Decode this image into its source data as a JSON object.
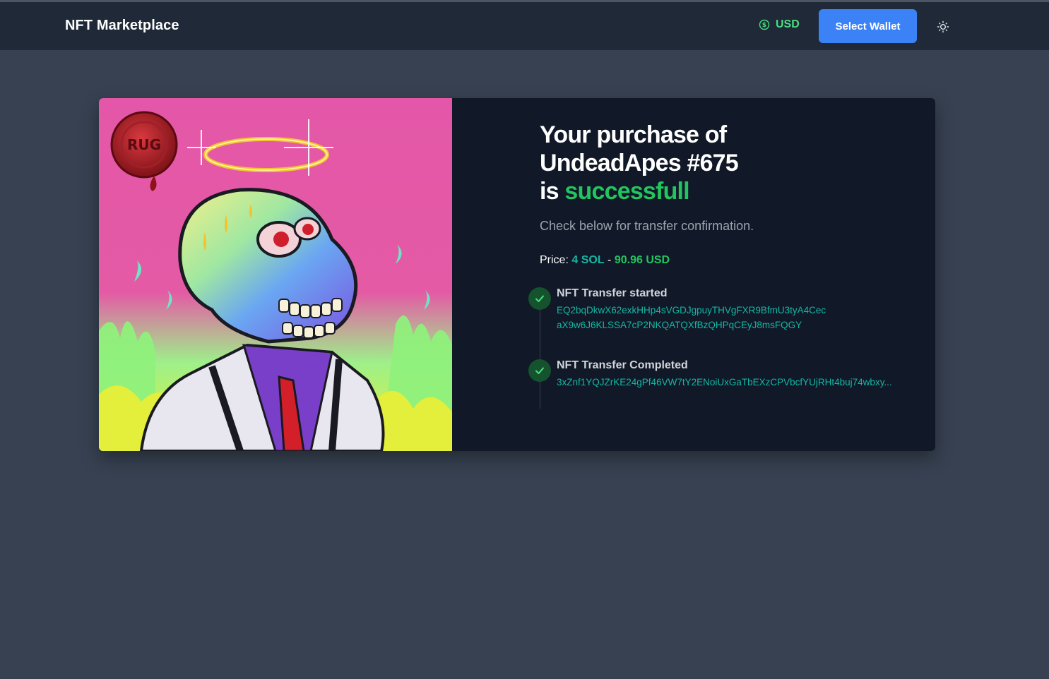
{
  "header": {
    "brand": "NFT Marketplace",
    "currency_label": "USD",
    "currency_icon": "dollar-circle-icon",
    "wallet_button": "Select Wallet",
    "theme_icon": "sun-icon"
  },
  "purchase": {
    "headline_prefix": "Your purchase of",
    "nft_name": "UndeadApes #675",
    "headline_is": "is",
    "headline_status": "successfull",
    "subtitle": "Check below for transfer confirmation.",
    "price_label": "Price:",
    "price_sol": "4 SOL",
    "price_separator": "-",
    "price_usd": "90.96 USD",
    "nft_badge_text": "RUG"
  },
  "timeline": [
    {
      "title": "NFT Transfer started",
      "hash": "EQ2bqDkwX62exkHHp4sVGDJgpuyTHVgFXR9BfmU3tyA4CecaX9w6J6KLSSA7cP2NKQATQXfBzQHPqCEyJ8msFQGY"
    },
    {
      "title": "NFT Transfer Completed",
      "hash": "3xZnf1YQJZrKE24gPf46VW7tY2ENoiUxGaTbEXzCPVbcfYUjRHt4buj74wbxy..."
    }
  ],
  "colors": {
    "page_bg": "#374151",
    "header_bg": "#1f2937",
    "card_bg": "#111827",
    "accent_blue": "#3b82f6",
    "success_green": "#22c55e",
    "teal": "#14b8a6"
  }
}
